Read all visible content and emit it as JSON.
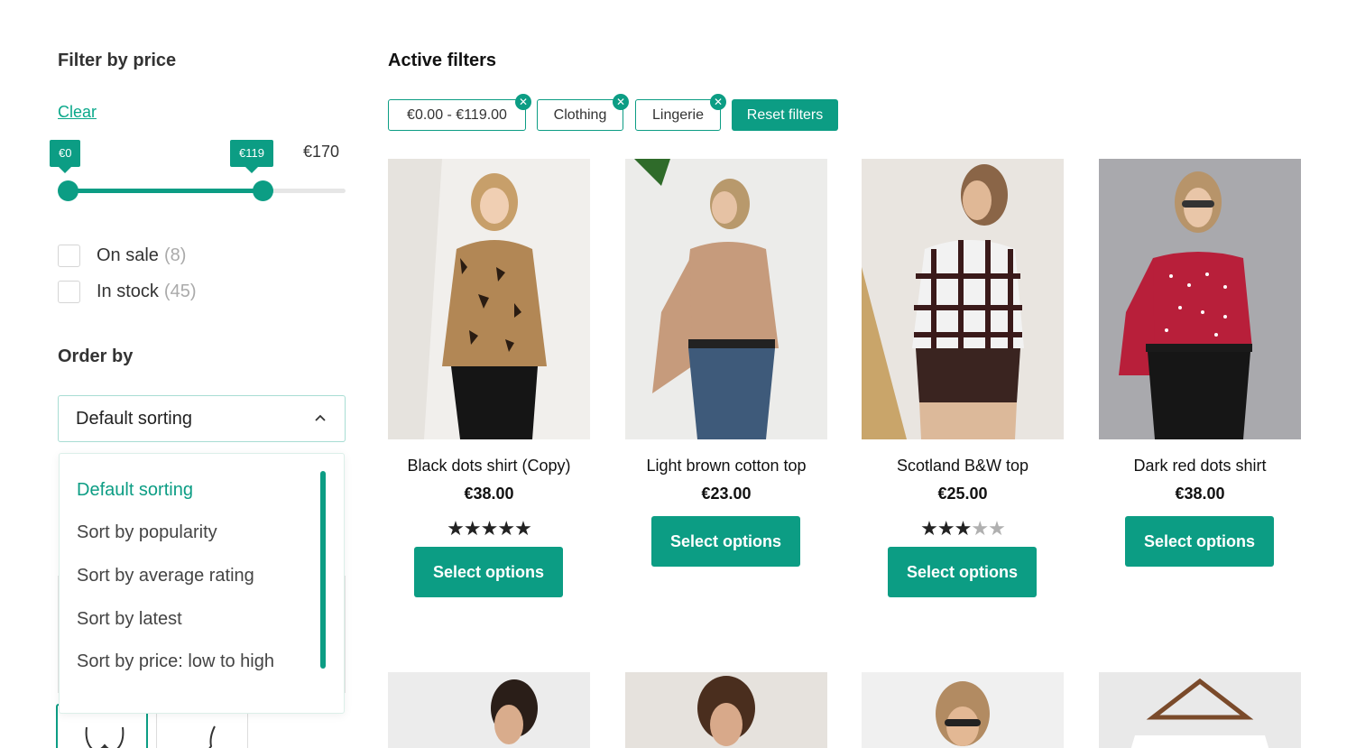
{
  "sidebar": {
    "price_filter": {
      "title": "Filter by price",
      "clear_label": "Clear",
      "min_tag": "€0",
      "max_tag": "€119",
      "range_max_label": "€170",
      "range_min_value": 0,
      "range_selected_max": 119,
      "range_max_value": 170
    },
    "checkboxes": [
      {
        "label": "On sale",
        "count": "(8)"
      },
      {
        "label": "In stock",
        "count": "(45)"
      }
    ],
    "order_by": {
      "title": "Order by",
      "selected": "Default sorting",
      "options": [
        "Default sorting",
        "Sort by popularity",
        "Sort by average rating",
        "Sort by latest",
        "Sort by price: low to high"
      ]
    }
  },
  "main": {
    "active_filters_title": "Active filters",
    "chips": [
      {
        "label": "€0.00 - €119.00",
        "remove_icon": "close-icon"
      },
      {
        "label": "Clothing",
        "remove_icon": "close-icon"
      },
      {
        "label": "Lingerie",
        "remove_icon": "close-icon"
      }
    ],
    "reset_label": "Reset filters",
    "products": [
      {
        "name": "Black dots shirt (Copy)",
        "price": "€38.00",
        "rating": 5,
        "button": "Select options"
      },
      {
        "name": "Light brown cotton top",
        "price": "€23.00",
        "rating": null,
        "button": "Select options"
      },
      {
        "name": "Scotland B&W top",
        "price": "€25.00",
        "rating": 3,
        "button": "Select options"
      },
      {
        "name": "Dark red dots shirt",
        "price": "€38.00",
        "rating": null,
        "button": "Select options"
      }
    ]
  },
  "colors": {
    "accent": "#0c9d84",
    "star_on": "#222222",
    "star_off": "#b0b0b0"
  }
}
